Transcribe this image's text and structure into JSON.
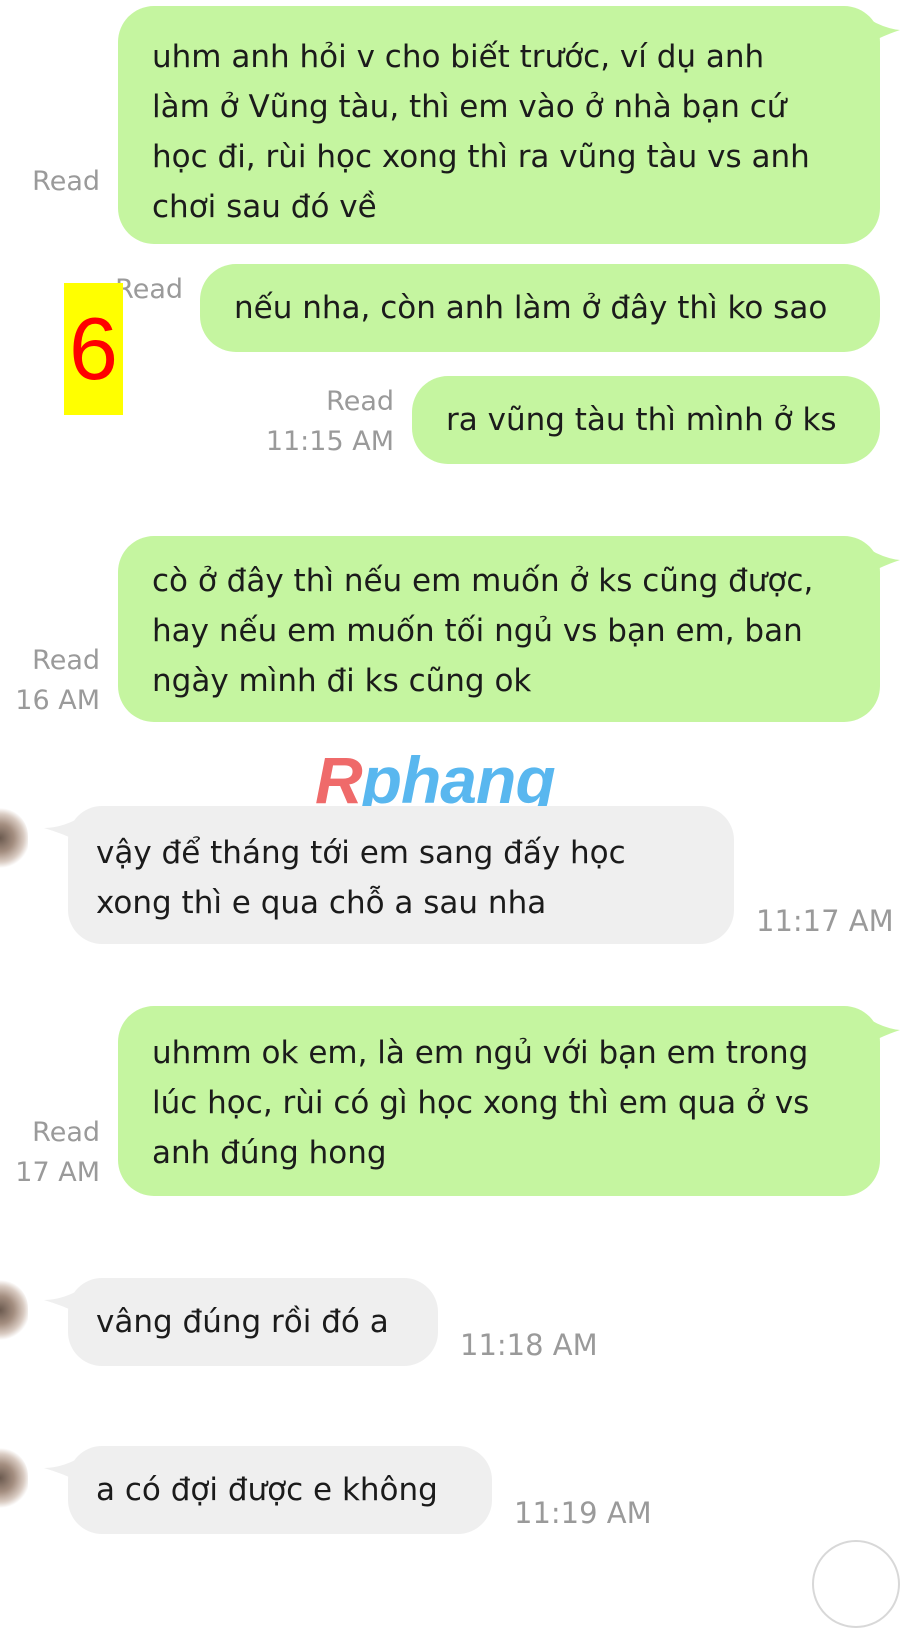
{
  "badge_number": "6",
  "watermark": {
    "part1": "R",
    "part2": "phang"
  },
  "messages": [
    {
      "direction": "out",
      "lines": [
        "uhm anh hỏi v cho biết trước, ví dụ anh",
        "làm ở Vũng tàu, thì em vào ở nhà bạn cứ",
        "học đi, rùi học xong thì ra vũng tàu vs anh",
        "chơi sau đó về"
      ],
      "status": "Read"
    },
    {
      "direction": "out",
      "lines": [
        "nếu nha, còn anh làm ở đây thì ko sao"
      ],
      "status": "Read"
    },
    {
      "direction": "out",
      "lines": [
        "ra vũng tàu thì mình ở ks"
      ],
      "status": "Read",
      "time": "11:15 AM"
    },
    {
      "direction": "out",
      "lines": [
        "cò ở đây thì nếu em muốn ở ks cũng được,",
        "hay nếu em muốn tối ngủ vs bạn em, ban",
        "ngày mình đi ks cũng ok"
      ],
      "status": "Read",
      "time": "16 AM"
    },
    {
      "direction": "in",
      "lines": [
        "vậy để tháng tới em sang đấy học",
        "xong thì e qua chỗ a sau nha"
      ],
      "time": "11:17 AM"
    },
    {
      "direction": "out",
      "lines": [
        "uhmm ok em, là em ngủ với bạn em trong",
        "lúc học, rùi có gì học xong thì em qua ở vs",
        "anh đúng hong"
      ],
      "status": "Read",
      "time": "17 AM"
    },
    {
      "direction": "in",
      "lines": [
        "vâng đúng rồi đó a"
      ],
      "time": "11:18 AM"
    },
    {
      "direction": "in",
      "lines": [
        "a có đợi được e không"
      ],
      "time": "11:19 AM"
    }
  ],
  "colors": {
    "outgoing_bubble": "#c5f5a0",
    "incoming_bubble": "#efefef",
    "meta_text": "#9a9a9a",
    "badge_bg": "#ffff00",
    "badge_text": "#ff0000"
  }
}
